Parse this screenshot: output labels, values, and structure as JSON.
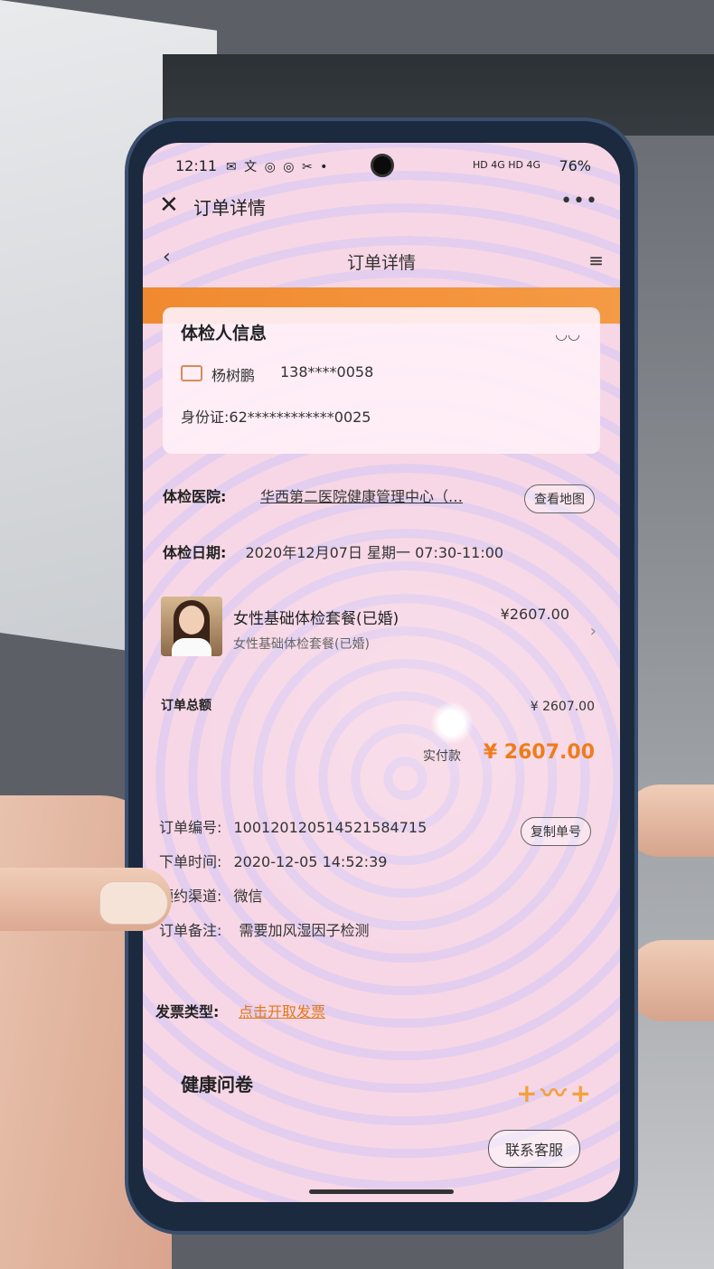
{
  "status_bar": {
    "time": "12:11",
    "left_icons": "✉ 文 ◎ ◎ ✂ •",
    "right_icons": "HD 4G HD 4G",
    "battery": "76%"
  },
  "wechat_bar": {
    "title": "订单详情",
    "close_icon": "✕",
    "more_icon": "•••"
  },
  "nav": {
    "back_icon": "‹",
    "title": "订单详情",
    "menu_icon": "≡"
  },
  "examinee": {
    "title": "体检人信息",
    "name": "杨树鹏",
    "phone": "138****0058",
    "id_label": "身份证:",
    "id_value": "62************0025",
    "eye_icon": "◡◡"
  },
  "hospital": {
    "label": "体检医院:",
    "value": "华西第二医院健康管理中心（…",
    "map_button": "查看地图"
  },
  "date": {
    "label": "体检日期:",
    "value": "2020年12月07日 星期一 07:30-11:00"
  },
  "package": {
    "name": "女性基础体检套餐(已婚)",
    "subtitle": "女性基础体检套餐(已婚)",
    "price": "¥2607.00"
  },
  "totals": {
    "total_label": "订单总额",
    "total_value": "¥ 2607.00",
    "paid_label": "实付款",
    "paid_value": "¥ 2607.00"
  },
  "order_info": {
    "number_label": "订单编号:",
    "number_value": "1001201205145215847​15",
    "copy_button": "复制单号",
    "time_label": "下单时间:",
    "time_value": "2020-12-05 14:52:39",
    "channel_label": "预约渠道:",
    "channel_value": "微信",
    "note_label": "订单备注:",
    "note_value": "需要加风湿因子检测"
  },
  "invoice": {
    "label": "发票类型:",
    "link": "点击开取发票"
  },
  "questionnaire": {
    "title": "健康问卷"
  },
  "contact_button": "联系客服",
  "colors": {
    "accent": "#f07c1a",
    "band": "#f08a30"
  }
}
